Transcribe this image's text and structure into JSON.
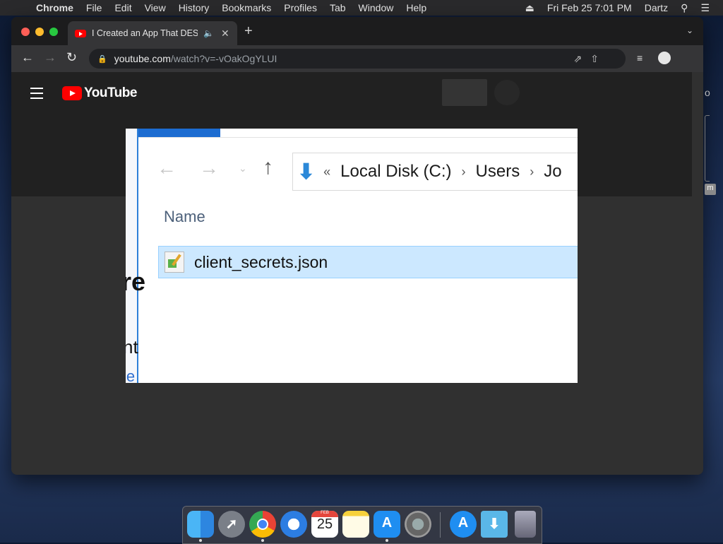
{
  "menubar": {
    "apple": "",
    "app_name": "Chrome",
    "items": [
      "File",
      "Edit",
      "View",
      "History",
      "Bookmarks",
      "Profiles",
      "Tab",
      "Window",
      "Help"
    ],
    "datetime": "Fri Feb 25  7:01 PM",
    "user": "Dartz"
  },
  "browser": {
    "tab_title": "I Created an App That DES",
    "address_host": "youtube.com",
    "address_path": "/watch?v=-vOakOgYLUI"
  },
  "youtube": {
    "logo_text": "YouTube"
  },
  "video": {
    "address_crumbs": [
      "Local Disk (C:)",
      "Users",
      "Jo"
    ],
    "column_header": "Name",
    "file_name": "client_secrets.json",
    "bg_frag1": "re",
    "bg_frag2": "nt",
    "bg_frag3": "le"
  },
  "dock": {
    "calendar_month": "FEB",
    "calendar_day": "25",
    "items": [
      "Finder",
      "Launchpad",
      "Google Chrome",
      "Safari",
      "Calendar",
      "Notes",
      "App Store",
      "System Preferences",
      "App Store",
      "Downloads",
      "Trash"
    ]
  },
  "sliver": {
    "letter_o": "o",
    "badge": "m"
  }
}
